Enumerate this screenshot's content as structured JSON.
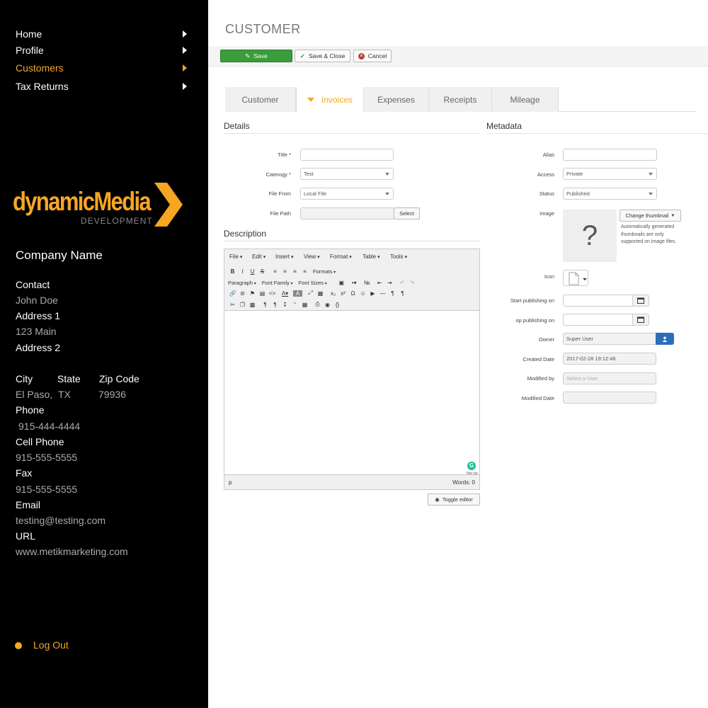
{
  "nav": {
    "items": [
      {
        "label": "Home"
      },
      {
        "label": "Profile"
      },
      {
        "label": "Customers"
      },
      {
        "label": "Tax Returns"
      }
    ]
  },
  "logo": {
    "main": "dynamicMedia",
    "sub": "DEVELOPMENT"
  },
  "company": {
    "name": "Company Name",
    "contact_label": "Contact",
    "contact_value": "John Doe",
    "address1_label": "Address 1",
    "address1_value": "123 Main",
    "address2_label": "Address 2",
    "city_label": "City",
    "state_label": "State",
    "zip_label": "Zip Code",
    "city_value": "El Paso,",
    "state_value": "TX",
    "zip_value": "79936",
    "phone_label": "Phone",
    "phone_value": "915-444-4444",
    "cell_label": "Cell Phone",
    "cell_value": "915-555-5555",
    "fax_label": "Fax",
    "fax_value": "915-555-5555",
    "email_label": "Email",
    "email_value": "testing@testing.com",
    "url_label": "URL",
    "url_value": "www.metikmarketing.com"
  },
  "logout": "Log Out",
  "page_title": "CUSTOMER",
  "toolbar": {
    "save": "Save",
    "save_close": "Save & Close",
    "cancel": "Cancel"
  },
  "tabs": [
    {
      "label": "Customer"
    },
    {
      "label": "Invoices"
    },
    {
      "label": "Expenses"
    },
    {
      "label": "Receipts"
    },
    {
      "label": "Mileage"
    }
  ],
  "details": {
    "heading": "Details",
    "title_label": "Title *",
    "title_value": "",
    "category_label": "Caterogy *",
    "category_value": "Test",
    "file_from_label": "File From",
    "file_from_value": "Local File",
    "file_path_label": "File Path",
    "select_btn": "Select"
  },
  "description": {
    "heading": "Description",
    "menus": [
      "File",
      "Edit",
      "Insert",
      "View",
      "Format",
      "Table",
      "Tools"
    ],
    "formats": "Formats",
    "paragraph": "Paragraph",
    "font_family": "Font Family",
    "font_sizes": "Font Sizes",
    "grammarly_text": "Not sig",
    "path": "p",
    "words": "Words: 0",
    "toggle": "Toggle editor"
  },
  "metadata": {
    "heading": "Metadata",
    "alias_label": "Alias",
    "alias_value": "",
    "access_label": "Access",
    "access_value": "Private",
    "status_label": "Status",
    "status_value": "Published",
    "image_label": "Image",
    "change_thumb": "Change thumbnail",
    "thumb_note": "Automatically generated thumbnails are only supported on image files.",
    "icon_label": "Icon",
    "start_label": "Start publishing on",
    "stop_label": "op publishing on",
    "owner_label": "Owner",
    "owner_value": "Super User",
    "created_label": "Created Date",
    "created_value": "2017-02-28 19:12:46",
    "modified_by_label": "Modified by",
    "modified_by_placeholder": "Select a User",
    "modified_date_label": "Modified Date"
  },
  "colors": {
    "accent": "#f7a623",
    "sidebar": "#000000",
    "save": "#3b9c3b",
    "user_btn": "#2a6ebb"
  }
}
